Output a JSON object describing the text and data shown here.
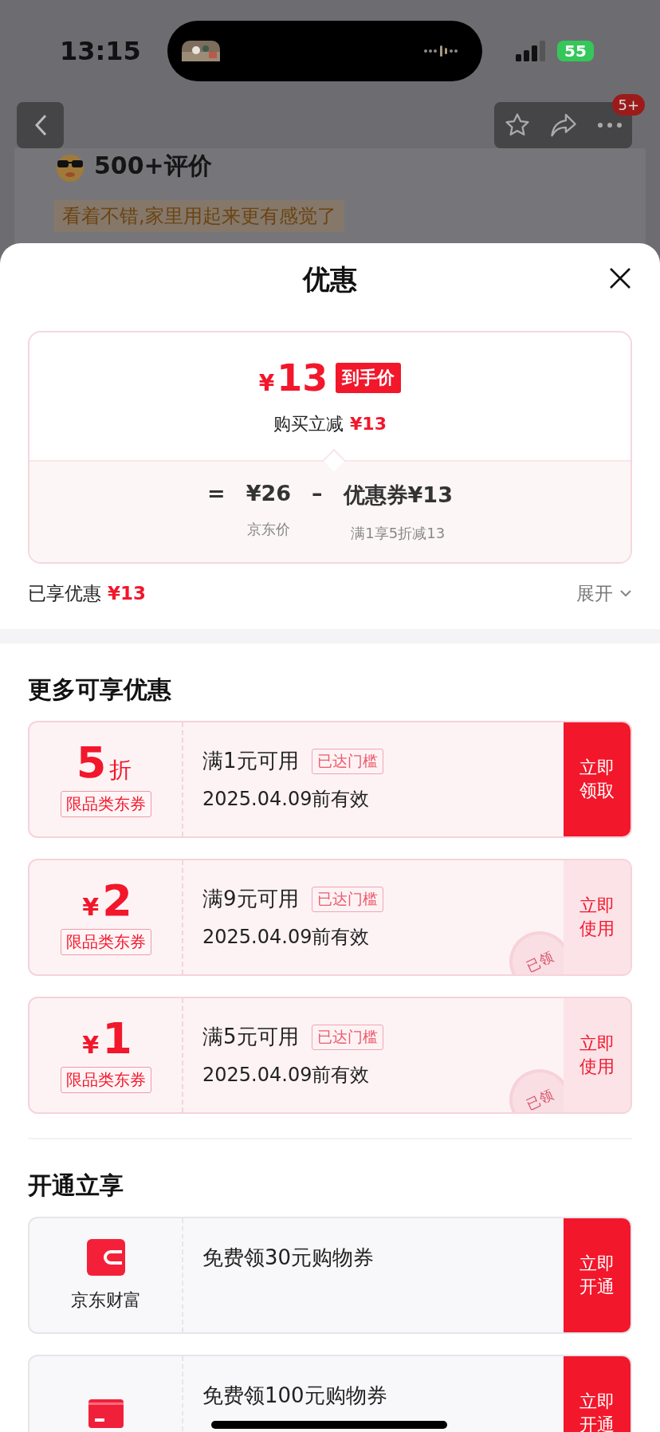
{
  "status_bar": {
    "time": "13:15",
    "battery": "55"
  },
  "background_page": {
    "badge": "5+",
    "reviews_title": "500+评价",
    "review_tag": "看着不错,家里用起来更有感觉了"
  },
  "sheet": {
    "title": "优惠"
  },
  "price_summary": {
    "final_currency": "¥",
    "final_amount": "13",
    "final_tag": "到手价",
    "reduction_label": "购买立减",
    "reduction_amount": "¥13",
    "formula": [
      {
        "kind": "operator",
        "text": "="
      },
      {
        "kind": "term",
        "value": "¥26",
        "caption": "京东价"
      },
      {
        "kind": "operator",
        "text": "–"
      },
      {
        "kind": "term",
        "value": "优惠券¥13",
        "caption": "满1享5折减13"
      }
    ]
  },
  "enjoyed": {
    "label": "已享优惠",
    "amount": "¥13",
    "toggle": "展开",
    "expanded": false
  },
  "more_offers": {
    "heading": "更多可享优惠",
    "coupons": [
      {
        "kind": "discount",
        "value": "5",
        "unit": "折",
        "tag": "限品类东券",
        "condition": "满1元可用",
        "badge": "已达门槛",
        "validity": "2025.04.09前有效",
        "action": "立即领取",
        "claimed": false
      },
      {
        "kind": "cash",
        "value": "2",
        "unit": "¥",
        "tag": "限品类东券",
        "condition": "满9元可用",
        "badge": "已达门槛",
        "validity": "2025.04.09前有效",
        "action": "立即使用",
        "claimed": true,
        "stamp": "已领"
      },
      {
        "kind": "cash",
        "value": "1",
        "unit": "¥",
        "tag": "限品类东券",
        "condition": "满5元可用",
        "badge": "已达门槛",
        "validity": "2025.04.09前有效",
        "action": "立即使用",
        "claimed": true,
        "stamp": "已领"
      }
    ]
  },
  "open_offers": {
    "heading": "开通立享",
    "services": [
      {
        "kind": "wallet",
        "name": "京东财富",
        "offer": "免费领30元购物券",
        "action": "立即开通"
      },
      {
        "kind": "card",
        "offer": "免费领100元购物券",
        "action": "立即开通"
      }
    ]
  }
}
